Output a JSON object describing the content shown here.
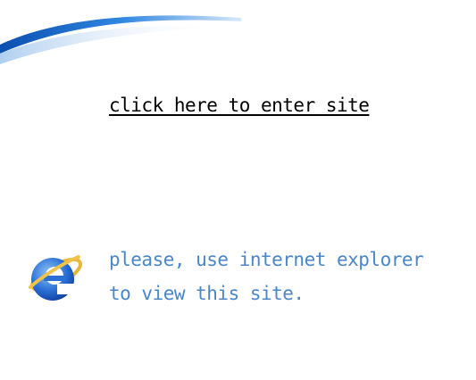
{
  "enter_link": {
    "label": "click here to enter site"
  },
  "notice": {
    "line1": "please, use internet explorer",
    "line2": "to view this site."
  },
  "icons": {
    "browser": "internet-explorer-icon",
    "decoration": "blue-swoosh"
  },
  "colors": {
    "background": "#ffffff",
    "link_text": "#000000",
    "notice_text": "#4a86c8",
    "swoosh": "#1f6fc8",
    "ie_blue": "#2a6fd6"
  }
}
